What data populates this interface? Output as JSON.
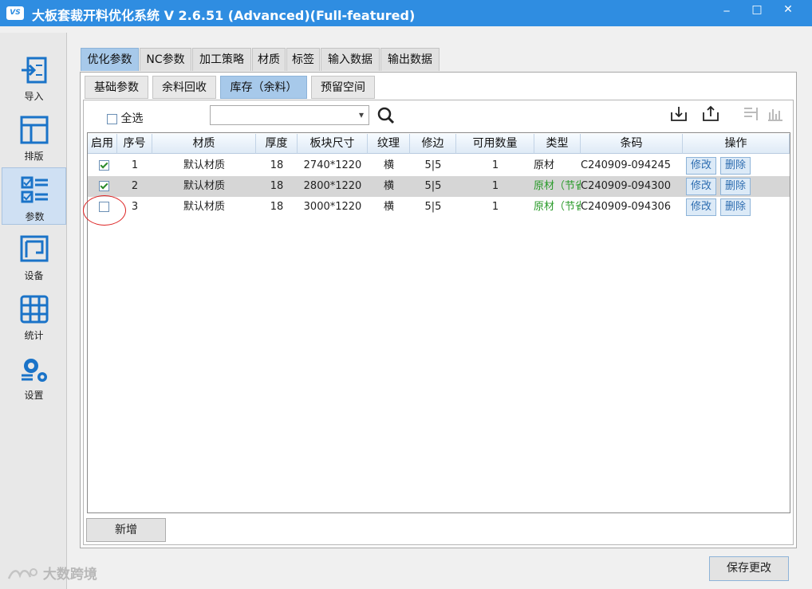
{
  "window": {
    "logo_text": "VS",
    "title": "大板套裁开料优化系统  V 2.6.51  (Advanced)(Full-featured)",
    "min_glyph": "_",
    "max_glyph": "□",
    "close_glyph": "✕"
  },
  "sidebar": {
    "items": [
      {
        "label": "导入",
        "icon": "import-icon"
      },
      {
        "label": "排版",
        "icon": "layout-icon"
      },
      {
        "label": "参数",
        "icon": "params-icon",
        "active": true
      },
      {
        "label": "设备",
        "icon": "device-icon"
      },
      {
        "label": "统计",
        "icon": "stats-icon"
      },
      {
        "label": "设置",
        "icon": "settings-icon"
      }
    ]
  },
  "main_tabs": [
    "优化参数",
    "NC参数",
    "加工策略",
    "材质",
    "标签",
    "输入数据",
    "输出数据"
  ],
  "sub_tabs": [
    "基础参数",
    "余料回收",
    "库存（余料）",
    "预留空间"
  ],
  "toolbar": {
    "select_all_label": "全选",
    "combo_value": "",
    "combo_arrow": "▾"
  },
  "table": {
    "headers": [
      "启用",
      "序号",
      "材质",
      "厚度",
      "板块尺寸",
      "纹理",
      "修边",
      "可用数量",
      "类型",
      "条码",
      "操作"
    ],
    "rows": [
      {
        "enabled": true,
        "index": "1",
        "material": "默认材质",
        "thickness": "18",
        "size": "2740*1220",
        "grain": "横",
        "trim": "5|5",
        "qty": "1",
        "type": "原材",
        "barcode": "C240909-094245",
        "edit": "修改",
        "delete": "删除"
      },
      {
        "enabled": true,
        "index": "2",
        "material": "默认材质",
        "thickness": "18",
        "size": "2800*1220",
        "grain": "横",
        "trim": "5|5",
        "qty": "1",
        "type": "原材（节省",
        "barcode": "C240909-094300",
        "edit": "修改",
        "delete": "删除"
      },
      {
        "enabled": false,
        "index": "3",
        "material": "默认材质",
        "thickness": "18",
        "size": "3000*1220",
        "grain": "横",
        "trim": "5|5",
        "qty": "1",
        "type": "原材（节省",
        "barcode": "C240909-094306",
        "edit": "修改",
        "delete": "删除"
      }
    ]
  },
  "buttons": {
    "add": "新增",
    "save": "保存更改"
  },
  "watermark": "大数跨境",
  "colors": {
    "titlebar": "#2f8de1",
    "active_tab": "#a7c9ea",
    "green_type": "#2a9a2a",
    "annotation_red": "#d22222"
  }
}
